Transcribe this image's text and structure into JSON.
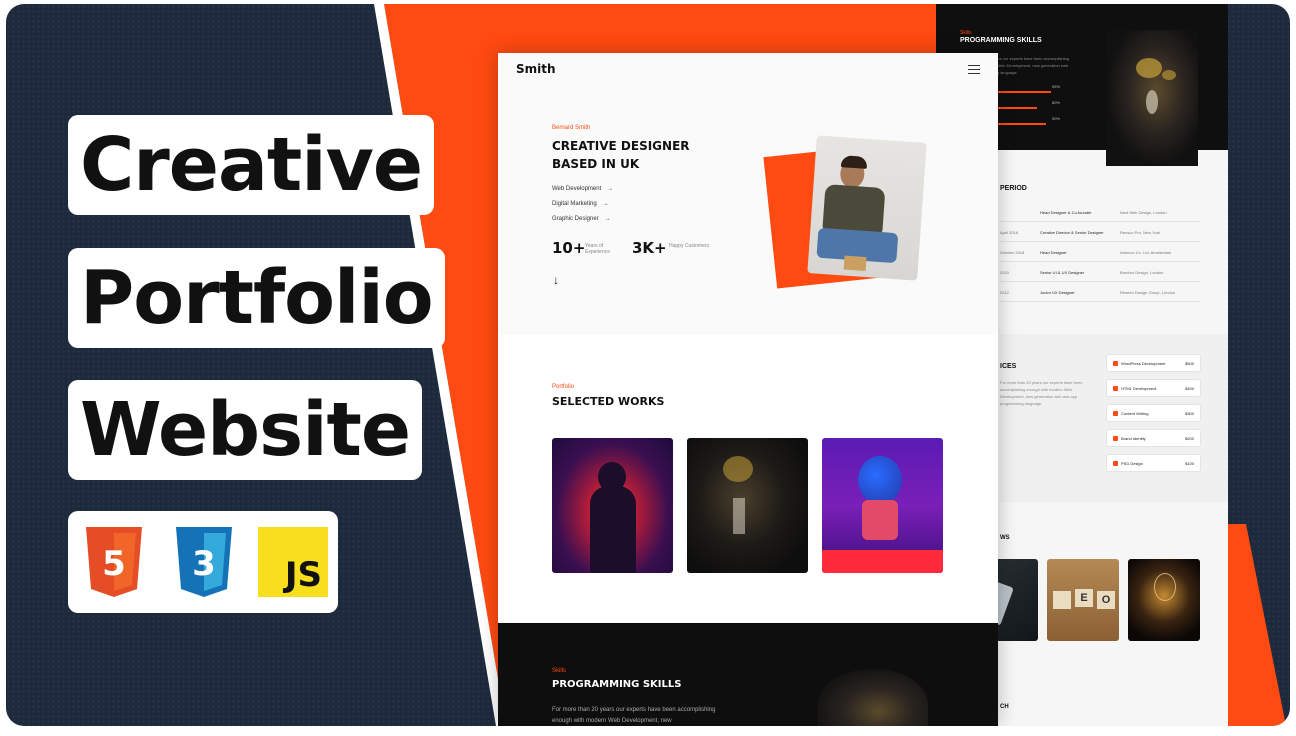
{
  "title_lines": [
    "Creative",
    "Portfolio",
    "Website"
  ],
  "tech_icons": [
    "html5-icon",
    "css3-icon",
    "javascript-icon"
  ],
  "tech_labels": {
    "html": "5",
    "css": "3",
    "js": "JS"
  },
  "colors": {
    "accent": "#ff4a12",
    "background": "#1d2a3d",
    "dark": "#0e0e0e"
  },
  "site": {
    "logo": "Smith",
    "hero": {
      "kicker": "Bernard Smith",
      "heading_line1": "CREATIVE DESIGNER",
      "heading_line2": "BASED IN UK",
      "roles": [
        "Web Development",
        "Digital Marketing",
        "Graphic Designer"
      ],
      "stats": [
        {
          "number": "10+",
          "label": "Years of Experience"
        },
        {
          "number": "3K+",
          "label": "Happy Customers"
        }
      ]
    },
    "works": {
      "kicker": "Portfolio",
      "heading": "SELECTED WORKS"
    },
    "skills": {
      "kicker": "Skills",
      "heading": "PROGRAMMING SKILLS",
      "paragraph": "For more than 20 years our experts have been accomplishing enough with modern Web Development, new"
    }
  },
  "back_page": {
    "skills_kicker": "Skills",
    "skills_heading": "PROGRAMMING SKILLS",
    "skills_para": "For more than 20 years our experts have been accomplishing enough with modern Web Development, new generation web and app programming language",
    "bars": [
      {
        "label": "95%",
        "level": 0.95
      },
      {
        "label": "80%",
        "level": 0.8
      },
      {
        "label": "90%",
        "level": 0.9
      }
    ],
    "period_heading": "PERIOD",
    "experience": [
      {
        "date": "",
        "role": "Head Designer & Co-founder",
        "company": "Next Web Design, London"
      },
      {
        "date": "April 2016",
        "role": "Creative Director & Senior Designer",
        "company": "Reusco Pro, New York"
      },
      {
        "date": "October 2018",
        "role": "Head Designer",
        "company": "Artwoon Co. Ltd, Amsterdam"
      },
      {
        "date": "2015",
        "role": "Senior UI & UX Designer",
        "company": "Bredoro Design, London"
      },
      {
        "date": "2012",
        "role": "Junior UX Designer",
        "company": "Reseen Design Group, London"
      }
    ],
    "services_heading": "ICES",
    "services_para": "For more than 20 years our experts have been accomplishing enough with modern Web Development, new generation web and app programming language.",
    "services": [
      {
        "name": "WordPress Development",
        "price": "$500"
      },
      {
        "name": "HTML Development",
        "price": "$400"
      },
      {
        "name": "Content Writing",
        "price": "$300"
      },
      {
        "name": "Brand Identity",
        "price": "$200"
      },
      {
        "name": "PSD Design",
        "price": "$100"
      }
    ],
    "news_heading": "WS",
    "contact_heading": "CH"
  }
}
